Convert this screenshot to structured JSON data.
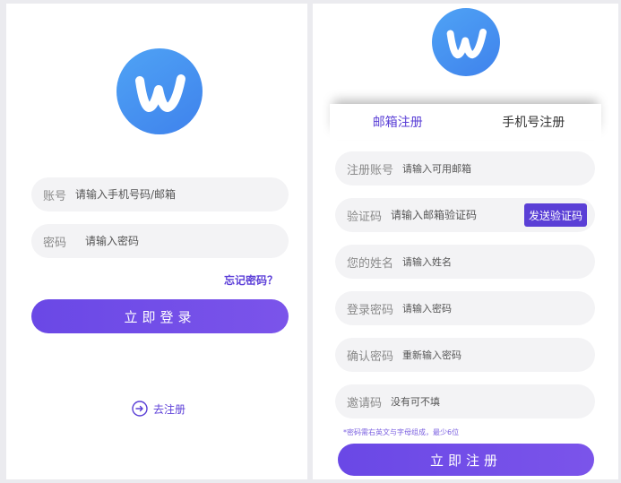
{
  "colors": {
    "accent": "#6b4be6",
    "logo_blue": "#4a90f0",
    "field_bg": "#f3f3f5"
  },
  "login": {
    "logo_icon": "w-logo-icon",
    "account": {
      "label": "账号",
      "placeholder": "请输入手机号码/邮箱"
    },
    "password": {
      "label": "密码",
      "placeholder": "请输入密码"
    },
    "forgot_link": "忘记密码？",
    "submit_label": "立即登录",
    "register_icon": "arrow-circle-right-icon",
    "register_link": "去注册"
  },
  "register": {
    "logo_icon": "w-logo-icon",
    "tabs": [
      {
        "label": "邮箱注册",
        "active": true
      },
      {
        "label": "手机号注册",
        "active": false
      }
    ],
    "fields": [
      {
        "label": "注册账号",
        "placeholder": "请输入可用邮箱"
      },
      {
        "label": "验证码",
        "placeholder": "请输入邮箱验证码",
        "button": "发送验证码"
      },
      {
        "label": "您的姓名",
        "placeholder": "请输入姓名"
      },
      {
        "label": "登录密码",
        "placeholder": "请输入密码"
      },
      {
        "label": "确认密码",
        "placeholder": "重新输入密码"
      },
      {
        "label": "邀请码",
        "placeholder": "没有可不填"
      }
    ],
    "hint": "*密码需右英文与字母组成，最少6位",
    "submit_label": "立即注册"
  }
}
